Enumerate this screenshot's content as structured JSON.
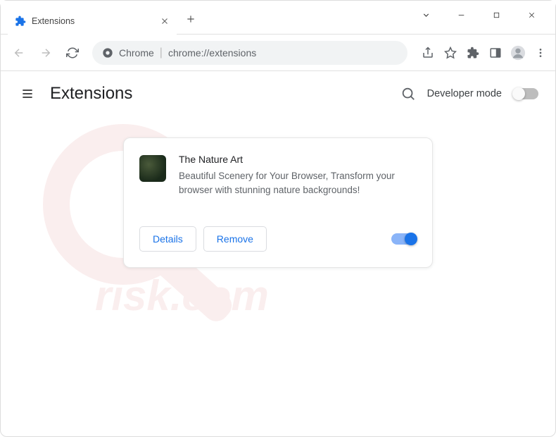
{
  "tab": {
    "title": "Extensions"
  },
  "omnibox": {
    "origin": "Chrome",
    "url": "chrome://extensions"
  },
  "page": {
    "title": "Extensions",
    "developer_mode_label": "Developer mode",
    "developer_mode_on": false
  },
  "extension": {
    "name": "The Nature Art",
    "description": "Beautiful Scenery for Your Browser, Transform your browser with stunning nature backgrounds!",
    "details_label": "Details",
    "remove_label": "Remove",
    "enabled": true
  }
}
